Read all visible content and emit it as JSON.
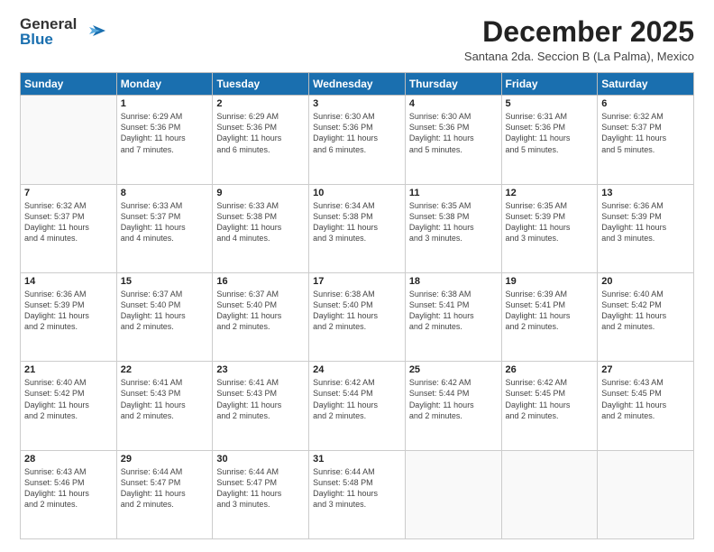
{
  "logo": {
    "general": "General",
    "blue": "Blue"
  },
  "title": "December 2025",
  "subtitle": "Santana 2da. Seccion B (La Palma), Mexico",
  "weekdays": [
    "Sunday",
    "Monday",
    "Tuesday",
    "Wednesday",
    "Thursday",
    "Friday",
    "Saturday"
  ],
  "weeks": [
    [
      {
        "day": "",
        "info": ""
      },
      {
        "day": "1",
        "info": "Sunrise: 6:29 AM\nSunset: 5:36 PM\nDaylight: 11 hours\nand 7 minutes."
      },
      {
        "day": "2",
        "info": "Sunrise: 6:29 AM\nSunset: 5:36 PM\nDaylight: 11 hours\nand 6 minutes."
      },
      {
        "day": "3",
        "info": "Sunrise: 6:30 AM\nSunset: 5:36 PM\nDaylight: 11 hours\nand 6 minutes."
      },
      {
        "day": "4",
        "info": "Sunrise: 6:30 AM\nSunset: 5:36 PM\nDaylight: 11 hours\nand 5 minutes."
      },
      {
        "day": "5",
        "info": "Sunrise: 6:31 AM\nSunset: 5:36 PM\nDaylight: 11 hours\nand 5 minutes."
      },
      {
        "day": "6",
        "info": "Sunrise: 6:32 AM\nSunset: 5:37 PM\nDaylight: 11 hours\nand 5 minutes."
      }
    ],
    [
      {
        "day": "7",
        "info": "Sunrise: 6:32 AM\nSunset: 5:37 PM\nDaylight: 11 hours\nand 4 minutes."
      },
      {
        "day": "8",
        "info": "Sunrise: 6:33 AM\nSunset: 5:37 PM\nDaylight: 11 hours\nand 4 minutes."
      },
      {
        "day": "9",
        "info": "Sunrise: 6:33 AM\nSunset: 5:38 PM\nDaylight: 11 hours\nand 4 minutes."
      },
      {
        "day": "10",
        "info": "Sunrise: 6:34 AM\nSunset: 5:38 PM\nDaylight: 11 hours\nand 3 minutes."
      },
      {
        "day": "11",
        "info": "Sunrise: 6:35 AM\nSunset: 5:38 PM\nDaylight: 11 hours\nand 3 minutes."
      },
      {
        "day": "12",
        "info": "Sunrise: 6:35 AM\nSunset: 5:39 PM\nDaylight: 11 hours\nand 3 minutes."
      },
      {
        "day": "13",
        "info": "Sunrise: 6:36 AM\nSunset: 5:39 PM\nDaylight: 11 hours\nand 3 minutes."
      }
    ],
    [
      {
        "day": "14",
        "info": "Sunrise: 6:36 AM\nSunset: 5:39 PM\nDaylight: 11 hours\nand 2 minutes."
      },
      {
        "day": "15",
        "info": "Sunrise: 6:37 AM\nSunset: 5:40 PM\nDaylight: 11 hours\nand 2 minutes."
      },
      {
        "day": "16",
        "info": "Sunrise: 6:37 AM\nSunset: 5:40 PM\nDaylight: 11 hours\nand 2 minutes."
      },
      {
        "day": "17",
        "info": "Sunrise: 6:38 AM\nSunset: 5:40 PM\nDaylight: 11 hours\nand 2 minutes."
      },
      {
        "day": "18",
        "info": "Sunrise: 6:38 AM\nSunset: 5:41 PM\nDaylight: 11 hours\nand 2 minutes."
      },
      {
        "day": "19",
        "info": "Sunrise: 6:39 AM\nSunset: 5:41 PM\nDaylight: 11 hours\nand 2 minutes."
      },
      {
        "day": "20",
        "info": "Sunrise: 6:40 AM\nSunset: 5:42 PM\nDaylight: 11 hours\nand 2 minutes."
      }
    ],
    [
      {
        "day": "21",
        "info": "Sunrise: 6:40 AM\nSunset: 5:42 PM\nDaylight: 11 hours\nand 2 minutes."
      },
      {
        "day": "22",
        "info": "Sunrise: 6:41 AM\nSunset: 5:43 PM\nDaylight: 11 hours\nand 2 minutes."
      },
      {
        "day": "23",
        "info": "Sunrise: 6:41 AM\nSunset: 5:43 PM\nDaylight: 11 hours\nand 2 minutes."
      },
      {
        "day": "24",
        "info": "Sunrise: 6:42 AM\nSunset: 5:44 PM\nDaylight: 11 hours\nand 2 minutes."
      },
      {
        "day": "25",
        "info": "Sunrise: 6:42 AM\nSunset: 5:44 PM\nDaylight: 11 hours\nand 2 minutes."
      },
      {
        "day": "26",
        "info": "Sunrise: 6:42 AM\nSunset: 5:45 PM\nDaylight: 11 hours\nand 2 minutes."
      },
      {
        "day": "27",
        "info": "Sunrise: 6:43 AM\nSunset: 5:45 PM\nDaylight: 11 hours\nand 2 minutes."
      }
    ],
    [
      {
        "day": "28",
        "info": "Sunrise: 6:43 AM\nSunset: 5:46 PM\nDaylight: 11 hours\nand 2 minutes."
      },
      {
        "day": "29",
        "info": "Sunrise: 6:44 AM\nSunset: 5:47 PM\nDaylight: 11 hours\nand 2 minutes."
      },
      {
        "day": "30",
        "info": "Sunrise: 6:44 AM\nSunset: 5:47 PM\nDaylight: 11 hours\nand 3 minutes."
      },
      {
        "day": "31",
        "info": "Sunrise: 6:44 AM\nSunset: 5:48 PM\nDaylight: 11 hours\nand 3 minutes."
      },
      {
        "day": "",
        "info": ""
      },
      {
        "day": "",
        "info": ""
      },
      {
        "day": "",
        "info": ""
      }
    ]
  ]
}
